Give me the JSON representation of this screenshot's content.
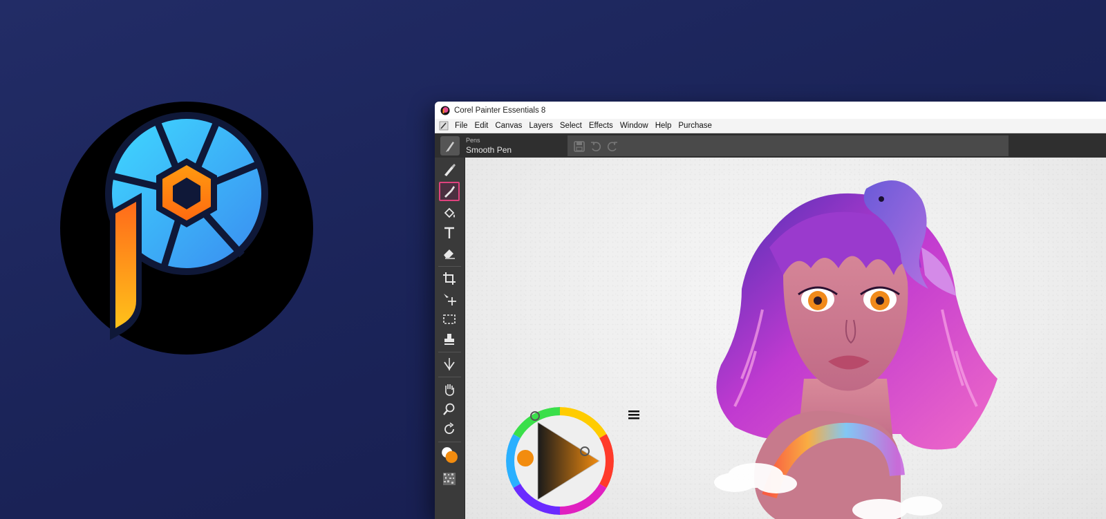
{
  "window": {
    "title": "Corel Painter Essentials 8"
  },
  "menu": [
    "File",
    "Edit",
    "Canvas",
    "Layers",
    "Select",
    "Effects",
    "Window",
    "Help",
    "Purchase"
  ],
  "brush": {
    "category": "Pens",
    "variant": "Smooth Pen"
  },
  "toolbox": [
    "brush-tool",
    "dropper-tool",
    "paint-bucket-tool",
    "text-tool",
    "eraser-tool",
    "crop-tool",
    "transform-tool",
    "rectangular-selection-tool",
    "clone-stamp-tool",
    "mirror-tool",
    "grabber-tool",
    "magnifier-tool",
    "rotate-page-tool",
    "color-swatch",
    "paper-texture-selector"
  ],
  "colors": {
    "accent_active_tool": "#e0427e",
    "main_color": "#f28c0f",
    "secondary_color": "#ffffff",
    "background_gradient_top": "#222c66",
    "background_gradient_bottom": "#161c4c"
  }
}
